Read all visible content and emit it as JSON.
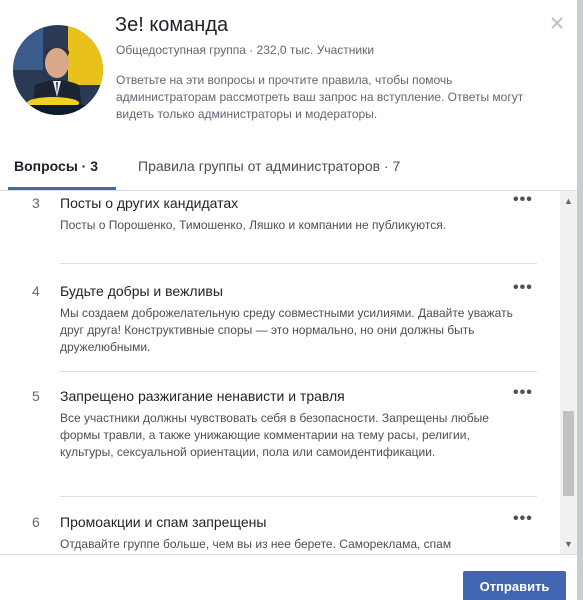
{
  "header": {
    "title": "Зе! команда",
    "subtitle": "Общедоступная группа · 232,0 тыс. Участники",
    "description": "Ответьте на эти вопросы и прочтите правила, чтобы помочь администраторам рассмотреть ваш запрос на вступление. Ответы могут видеть только администраторы и модераторы.",
    "close_icon": "close-icon"
  },
  "tabs": [
    {
      "label": "Вопросы · 3"
    },
    {
      "label": "Правила группы от администраторов · 7"
    }
  ],
  "rules": [
    {
      "number": "3",
      "title": "Посты о других кандидатах",
      "body": "Посты о Порошенко, Тимошенко, Ляшко и компании не публикуются.",
      "more": "•••"
    },
    {
      "number": "4",
      "title": "Будьте добры и вежливы",
      "body": "Мы создаем доброжелательную среду совместными усилиями. Давайте уважать друг друга! Конструктивные споры — это нормально, но они должны быть дружелюбными.",
      "more": "•••"
    },
    {
      "number": "5",
      "title": "Запрещено разжигание ненависти и травля",
      "body": "Все участники должны чувствовать себя в безопасности. Запрещены любые формы травли, а также унижающие комментарии на тему расы, религии, культуры, сексуальной ориентации, пола или самоидентификации.",
      "more": "•••"
    },
    {
      "number": "6",
      "title": "Промоакции и спам запрещены",
      "body": "Отдавайте группе больше, чем вы из нее берете. Самореклама, спам",
      "more": "•••"
    }
  ],
  "footer": {
    "submit_label": "Отправить"
  },
  "colors": {
    "accent": "#4267b2",
    "text": "#1d2129",
    "muted": "#606770"
  }
}
